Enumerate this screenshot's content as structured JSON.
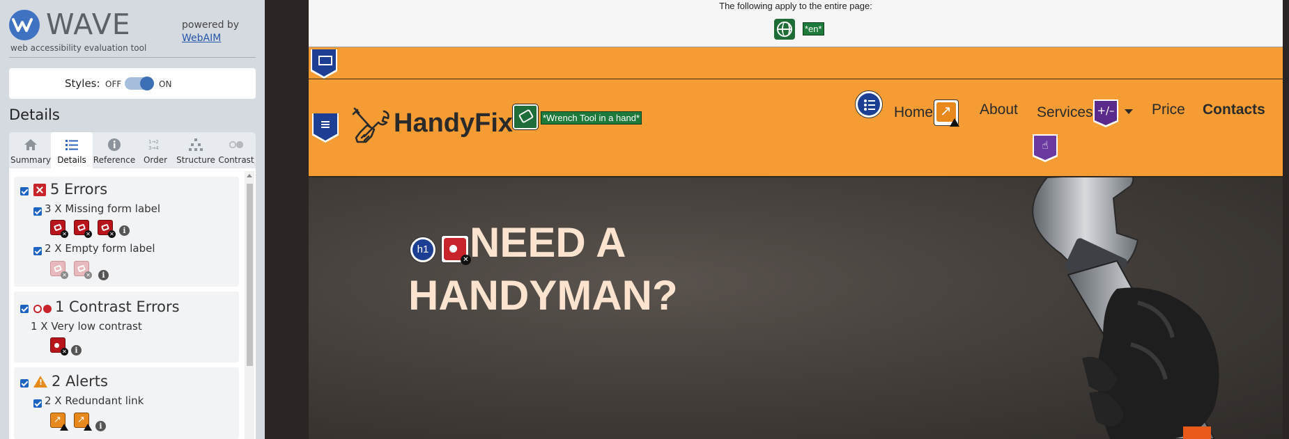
{
  "wave": {
    "title": "WAVE",
    "subtitle": "web accessibility evaluation tool",
    "powered_by": "powered by",
    "webaim_link": "WebAIM",
    "styles_label": "Styles:",
    "styles_off": "OFF",
    "styles_on": "ON",
    "styles_state": "on",
    "details_heading": "Details",
    "tabs": [
      {
        "label": "Summary",
        "icon": "home-icon"
      },
      {
        "label": "Details",
        "icon": "list-icon",
        "active": true
      },
      {
        "label": "Reference",
        "icon": "info-icon"
      },
      {
        "label": "Order",
        "icon": "order-icon"
      },
      {
        "label": "Structure",
        "icon": "structure-icon"
      },
      {
        "label": "Contrast",
        "icon": "contrast-icon"
      }
    ],
    "errors": {
      "title": "5 Errors",
      "items": [
        {
          "label": "3 X Missing form label"
        },
        {
          "label": "2 X Empty form label"
        }
      ]
    },
    "contrast": {
      "title": "1 Contrast Errors",
      "items": [
        {
          "label": "1 X Very low contrast"
        }
      ]
    },
    "alerts": {
      "title": "2 Alerts",
      "items": [
        {
          "label": "2 X Redundant link"
        }
      ]
    }
  },
  "page": {
    "applies_text": "The following apply to the entire page:",
    "lang_tag": "*en*",
    "brand_name": "HandyFix",
    "logo_alt_tag": "*Wrench Tool in a hand*",
    "nav": {
      "home": "Home",
      "about": "About",
      "services": "Services",
      "price": "Price",
      "contacts": "Contacts"
    },
    "aria_plus_minus": "+/–",
    "h1_badge": "h1",
    "hero_line1": "NEED A",
    "hero_line2": "HANDYMAN?"
  },
  "colors": {
    "wave_blue": "#3f72c0",
    "error_red": "#c8242b",
    "alert_orange": "#e88a1a",
    "site_orange": "#f59c35",
    "hero_text": "#fbe3cf",
    "structure_blue": "#1c3f94",
    "aria_purple": "#5b2b8c",
    "feature_green": "#1d7a3a"
  }
}
